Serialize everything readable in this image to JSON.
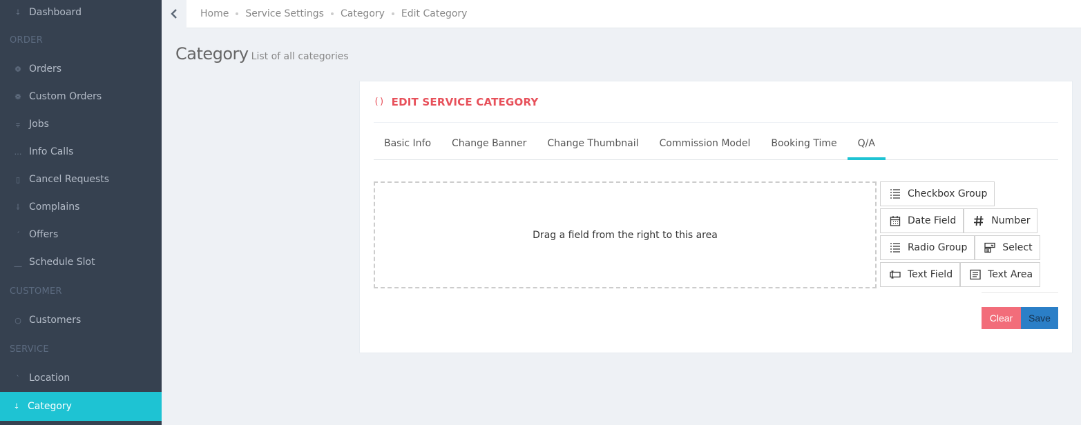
{
  "sidebar": {
    "items": [
      {
        "label": "Dashboard",
        "icon": "dashboard-icon"
      },
      {
        "section": "ORDER"
      },
      {
        "label": "Orders",
        "icon": "orders-icon"
      },
      {
        "label": "Custom Orders",
        "icon": "custom-orders-icon"
      },
      {
        "label": "Jobs",
        "icon": "jobs-icon"
      },
      {
        "label": "Info Calls",
        "icon": "info-calls-icon"
      },
      {
        "label": "Cancel Requests",
        "icon": "cancel-requests-icon"
      },
      {
        "label": "Complains",
        "icon": "complains-icon"
      },
      {
        "label": "Offers",
        "icon": "offers-icon"
      },
      {
        "label": "Schedule Slot",
        "icon": "schedule-slot-icon"
      },
      {
        "section": "CUSTOMER"
      },
      {
        "label": "Customers",
        "icon": "customers-icon"
      },
      {
        "section": "SERVICE"
      },
      {
        "label": "Location",
        "icon": "location-icon"
      },
      {
        "label": "Category",
        "icon": "category-icon",
        "active": true
      }
    ]
  },
  "breadcrumb": [
    "Home",
    "Service Settings",
    "Category",
    "Edit Category"
  ],
  "page": {
    "title": "Category",
    "subtitle": "List of all categories"
  },
  "portlet": {
    "icon": "()",
    "title": "EDIT SERVICE CATEGORY",
    "tabs": [
      "Basic Info",
      "Change Banner",
      "Change Thumbnail",
      "Commission Model",
      "Booking Time",
      "Q/A"
    ],
    "active_tab": "Q/A",
    "dropzone_text": "Drag a field from the right to this area",
    "fields": [
      [
        "Checkbox Group"
      ],
      [
        "Date Field",
        "Number"
      ],
      [
        "Radio Group",
        "Select"
      ],
      [
        "Text Field",
        "Text Area"
      ]
    ],
    "clear_label": "Clear",
    "save_label": "Save"
  },
  "colors": {
    "sidebar_bg": "#364150",
    "active_accent": "#1ec3d3",
    "title_red": "#e7505a",
    "clear_btn": "#f26d7a",
    "save_btn": "#2b7fc7"
  }
}
